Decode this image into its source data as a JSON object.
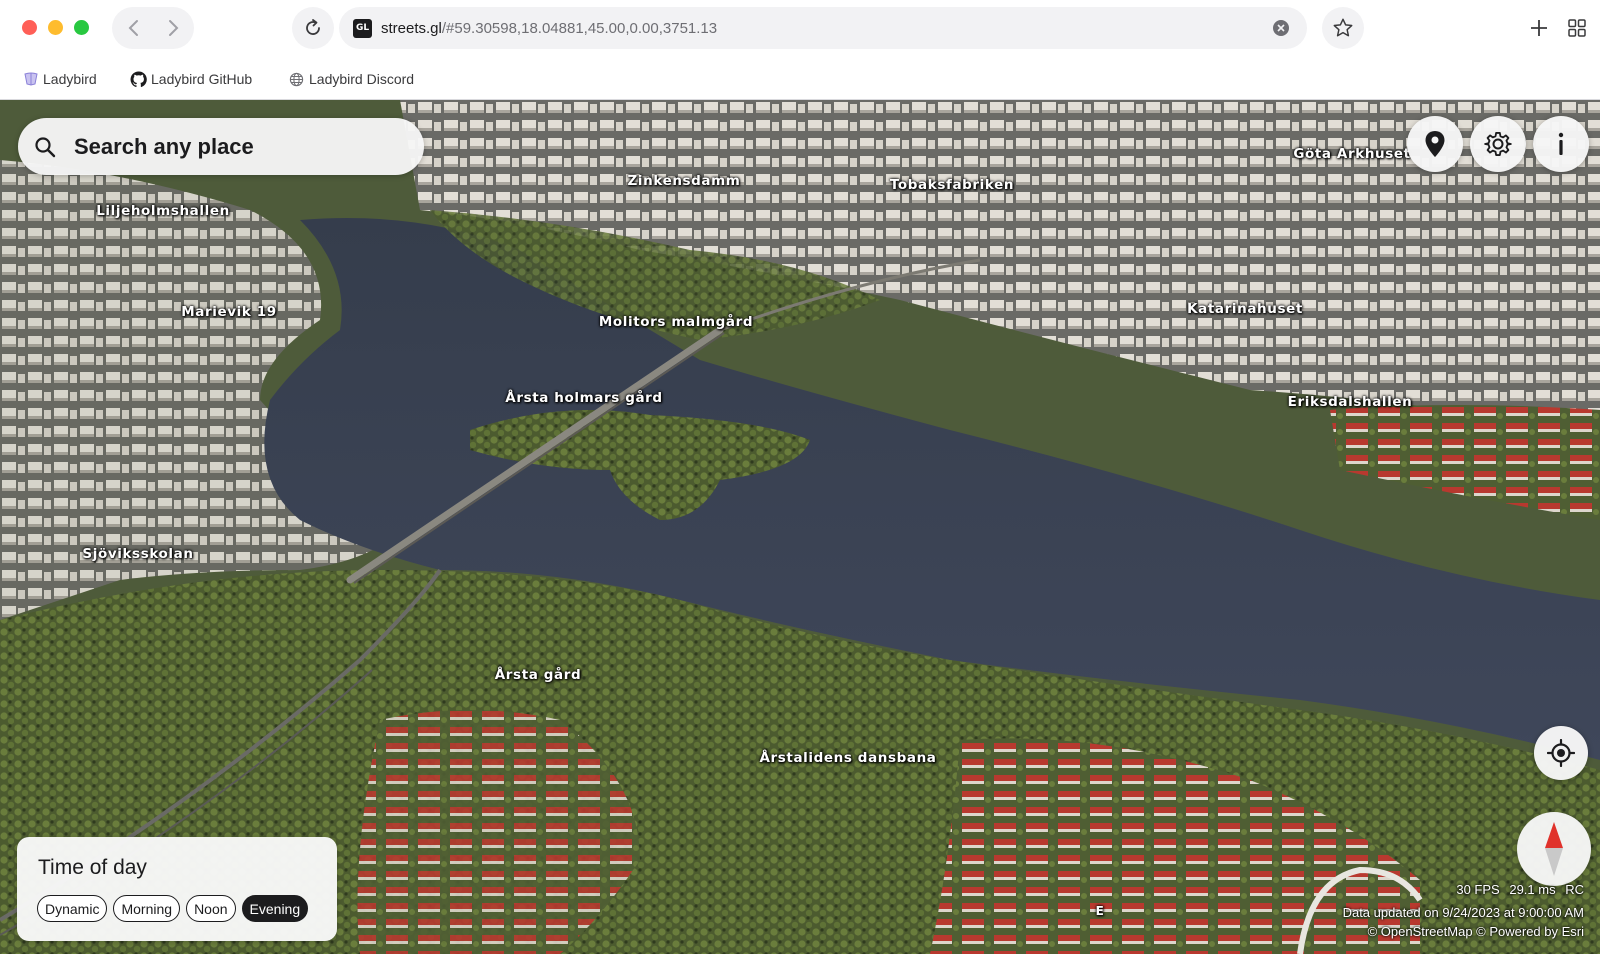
{
  "browser": {
    "url_host": "streets.gl",
    "url_path": "/#59.30598,18.04881,45.00,0.00,3751.13",
    "favicon_text": "GL",
    "bookmarks": [
      {
        "label": "Ladybird",
        "icon": "ladybird-icon"
      },
      {
        "label": "Ladybird GitHub",
        "icon": "github-icon"
      },
      {
        "label": "Ladybird Discord",
        "icon": "globe-icon"
      }
    ]
  },
  "search": {
    "placeholder": "Search any place"
  },
  "map": {
    "labels": [
      {
        "text": "Liljeholmshallen"
      },
      {
        "text": "Zinkensdamm"
      },
      {
        "text": "Tobaksfabriken"
      },
      {
        "text": "Göta Arkhuset"
      },
      {
        "text": "Marievik 19"
      },
      {
        "text": "Molitors malmgård"
      },
      {
        "text": "Katarinahuset"
      },
      {
        "text": "Årsta holmars gård"
      },
      {
        "text": "Eriksdalshallen"
      },
      {
        "text": "Sjöviksskolan"
      },
      {
        "text": "Årsta gård"
      },
      {
        "text": "Årstalidens dansbana"
      },
      {
        "text": "E"
      }
    ],
    "colors": {
      "water": "#3a4253",
      "forest": "#4a5a2e",
      "building": "#d9d5cc",
      "roof_red": "#b8392f"
    }
  },
  "time_of_day": {
    "title": "Time of day",
    "options": [
      "Dynamic",
      "Morning",
      "Noon",
      "Evening"
    ],
    "selected": "Evening"
  },
  "stats": {
    "fps": "30 FPS",
    "frametime": "29.1 ms",
    "rc": "RC",
    "data_updated": "Data updated on 9/24/2023 at 9:00:00 AM",
    "attribution": "© OpenStreetMap © Powered by Esri"
  },
  "icons": {
    "location": "map-pin-icon",
    "settings": "gear-icon",
    "info": "info-icon",
    "locate": "crosshair-icon",
    "compass": "compass-icon"
  }
}
